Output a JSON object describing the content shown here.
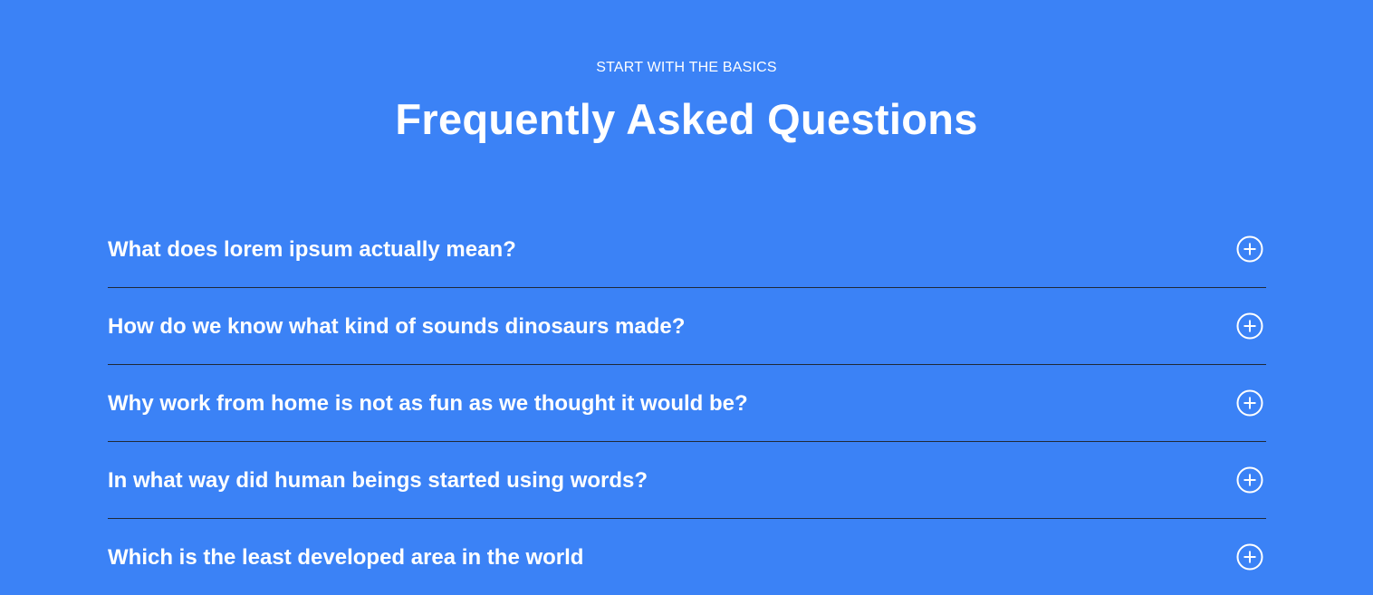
{
  "header": {
    "eyebrow": "START WITH THE BASICS",
    "title": "Frequently Asked Questions"
  },
  "faq": {
    "items": [
      {
        "question": "What does lorem ipsum actually mean?",
        "icon": "plus-circle-icon"
      },
      {
        "question": "How do we know what kind of sounds dinosaurs made?",
        "icon": "plus-circle-icon"
      },
      {
        "question": "Why work from home is not as fun as we thought it would be?",
        "icon": "plus-circle-icon"
      },
      {
        "question": "In what way did human beings started using words?",
        "icon": "plus-circle-icon"
      },
      {
        "question": "Which is the least developed area in the world",
        "icon": "plus-circle-icon"
      }
    ]
  },
  "colors": {
    "background": "#3b82f6",
    "text": "#ffffff",
    "divider": "#1f2937"
  }
}
